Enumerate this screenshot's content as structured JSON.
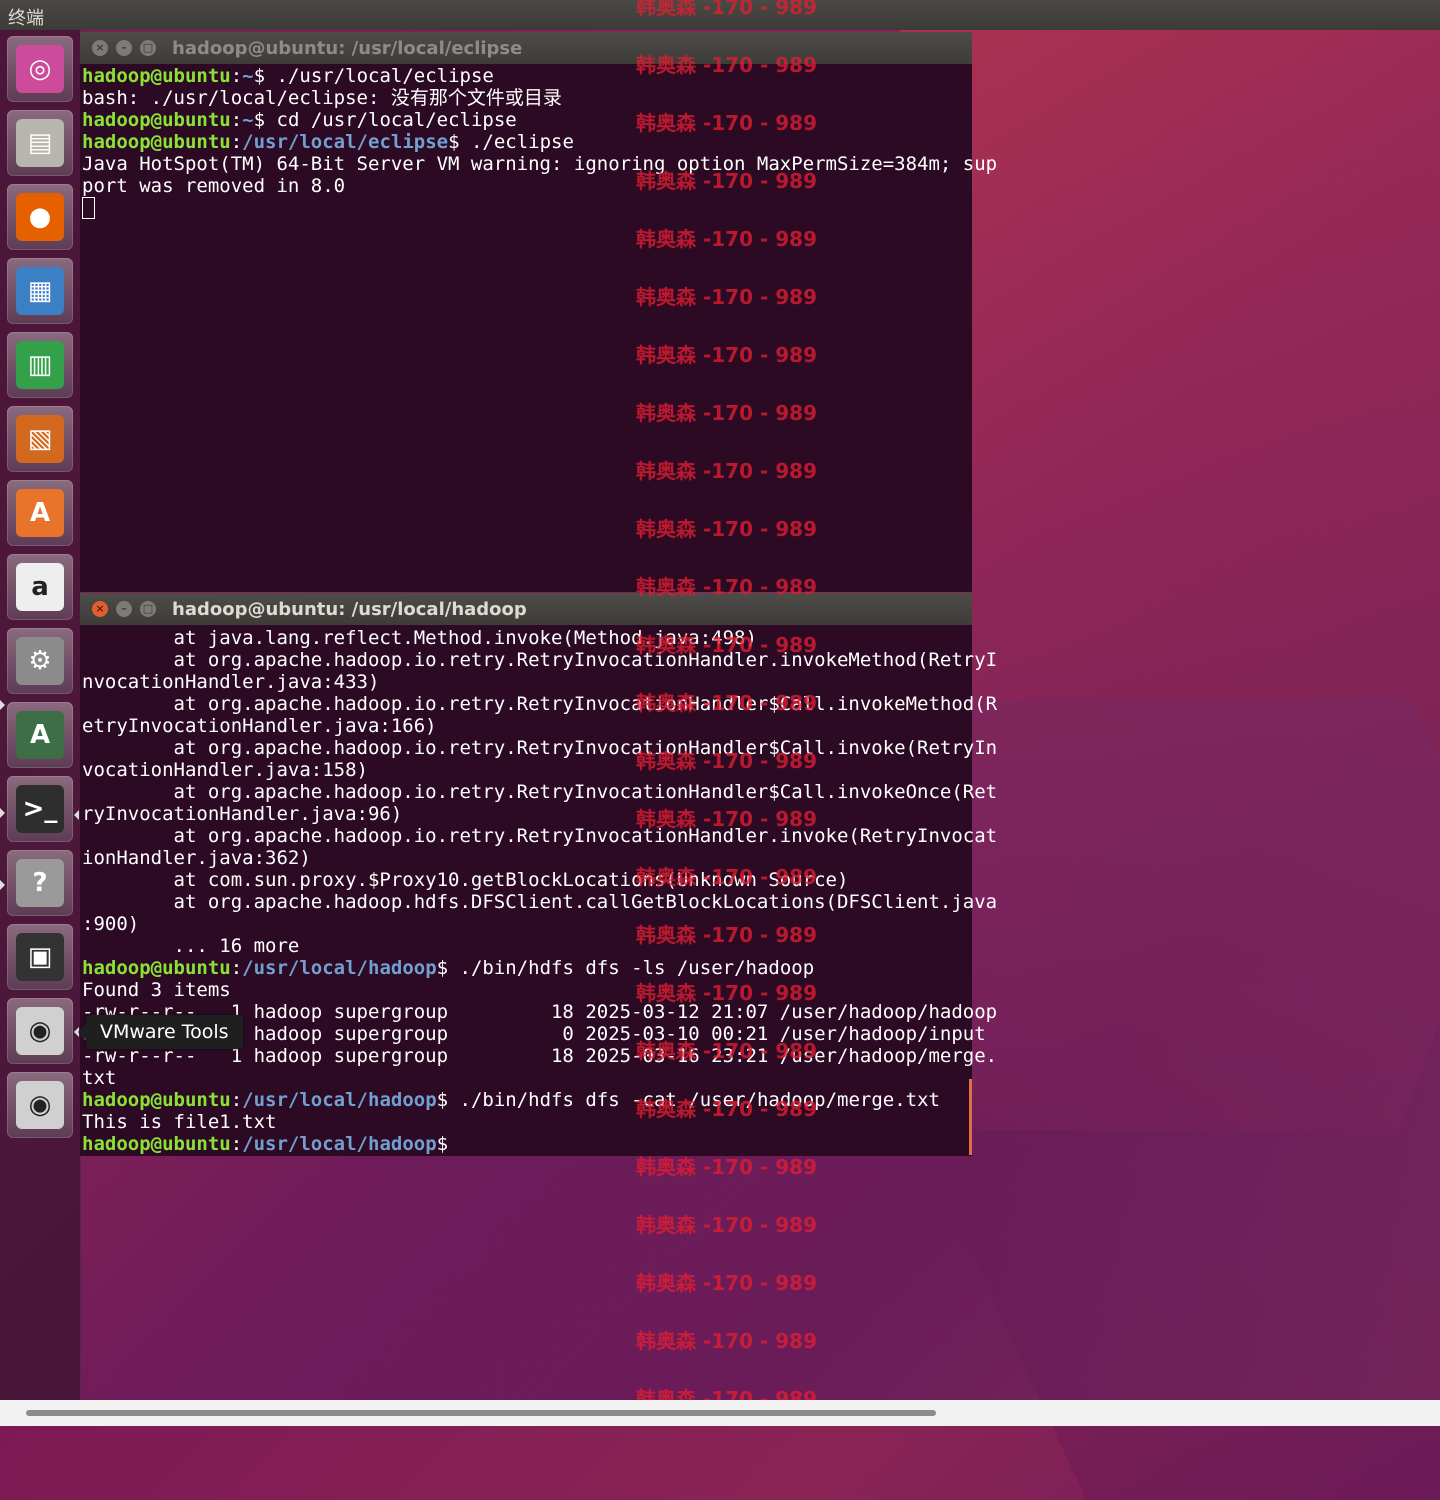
{
  "top_panel": {
    "title": "终端"
  },
  "launcher": {
    "items": [
      {
        "name": "ubuntu-dash",
        "icon": "ubuntu-logo-icon",
        "color": "#cc4b9b"
      },
      {
        "name": "files",
        "icon": "file-cabinet-icon",
        "color": "#b8b4ae"
      },
      {
        "name": "firefox",
        "icon": "firefox-icon",
        "color": "#e66000"
      },
      {
        "name": "libreoffice-writer",
        "icon": "document-icon",
        "color": "#3b7fc4"
      },
      {
        "name": "libreoffice-calc",
        "icon": "spreadsheet-icon",
        "color": "#33a04a"
      },
      {
        "name": "libreoffice-impress",
        "icon": "presentation-icon",
        "color": "#d2691e"
      },
      {
        "name": "software-center",
        "icon": "shopping-bag-icon",
        "color": "#e8742c"
      },
      {
        "name": "amazon",
        "icon": "amazon-icon",
        "color": "#eeeeee"
      },
      {
        "name": "system-settings",
        "icon": "gear-wrench-icon",
        "color": "#8b8b8b"
      },
      {
        "name": "software-updater",
        "icon": "updater-icon",
        "color": "#3d6e45"
      },
      {
        "name": "terminal",
        "icon": "terminal-icon",
        "color": "#2e2e2e"
      },
      {
        "name": "help",
        "icon": "question-mark-icon",
        "color": "#9a9a9a"
      },
      {
        "name": "save-disk",
        "icon": "floppy-disk-icon",
        "color": "#333333"
      },
      {
        "name": "vmware-tools-dvd",
        "icon": "dvd-icon",
        "color": "#d0d0d0"
      },
      {
        "name": "dvd-2",
        "icon": "dvd-icon",
        "color": "#d0d0d0"
      }
    ],
    "tooltip": "VMware Tools"
  },
  "terminal_back": {
    "title": "hadoop@ubuntu: /usr/local/eclipse",
    "lines": [
      {
        "user": "hadoop@ubuntu",
        "colon": ":",
        "path": "~",
        "prompt": "$ ",
        "cmd": "./usr/local/eclipse"
      },
      {
        "text": "bash: ./usr/local/eclipse: 没有那个文件或目录"
      },
      {
        "user": "hadoop@ubuntu",
        "colon": ":",
        "path": "~",
        "prompt": "$ ",
        "cmd": "cd /usr/local/eclipse"
      },
      {
        "user": "hadoop@ubuntu",
        "colon": ":",
        "path": "/usr/local/eclipse",
        "prompt": "$ ",
        "cmd": "./eclipse"
      },
      {
        "text": "Java HotSpot(TM) 64-Bit Server VM warning: ignoring option MaxPermSize=384m; sup"
      },
      {
        "text": "port was removed in 8.0"
      }
    ]
  },
  "terminal_front": {
    "title": "hadoop@ubuntu: /usr/local/hadoop",
    "lines": [
      {
        "text": "        at java.lang.reflect.Method.invoke(Method.java:498)"
      },
      {
        "text": "        at org.apache.hadoop.io.retry.RetryInvocationHandler.invokeMethod(RetryI"
      },
      {
        "text": "nvocationHandler.java:433)"
      },
      {
        "text": "        at org.apache.hadoop.io.retry.RetryInvocationHandler$Call.invokeMethod(R"
      },
      {
        "text": "etryInvocationHandler.java:166)"
      },
      {
        "text": "        at org.apache.hadoop.io.retry.RetryInvocationHandler$Call.invoke(RetryIn"
      },
      {
        "text": "vocationHandler.java:158)"
      },
      {
        "text": "        at org.apache.hadoop.io.retry.RetryInvocationHandler$Call.invokeOnce(Ret"
      },
      {
        "text": "ryInvocationHandler.java:96)"
      },
      {
        "text": "        at org.apache.hadoop.io.retry.RetryInvocationHandler.invoke(RetryInvocat"
      },
      {
        "text": "ionHandler.java:362)"
      },
      {
        "text": "        at com.sun.proxy.$Proxy10.getBlockLocations(Unknown Source)"
      },
      {
        "text": "        at org.apache.hadoop.hdfs.DFSClient.callGetBlockLocations(DFSClient.java"
      },
      {
        "text": ":900)"
      },
      {
        "text": "        ... 16 more"
      },
      {
        "user": "hadoop@ubuntu",
        "colon": ":",
        "path": "/usr/local/hadoop",
        "prompt": "$ ",
        "cmd": "./bin/hdfs dfs -ls /user/hadoop"
      },
      {
        "text": "Found 3 items"
      },
      {
        "text": "-rw-r--r--   1 hadoop supergroup         18 2025-03-12 21:07 /user/hadoop/hadoop"
      },
      {
        "text": "drwxr-xr-x   - hadoop supergroup          0 2025-03-10 00:21 /user/hadoop/input"
      },
      {
        "text": "-rw-r--r--   1 hadoop supergroup         18 2025-03-16 23:21 /user/hadoop/merge."
      },
      {
        "text": "txt"
      },
      {
        "user": "hadoop@ubuntu",
        "colon": ":",
        "path": "/usr/local/hadoop",
        "prompt": "$ ",
        "cmd": "./bin/hdfs dfs -cat /user/hadoop/merge.txt"
      },
      {
        "text": "This is file1.txt"
      },
      {
        "user": "hadoop@ubuntu",
        "colon": ":",
        "path": "/usr/local/hadoop",
        "prompt": "$",
        "cmd": ""
      }
    ]
  },
  "watermark": {
    "text": "韩奥森 -170 - 989",
    "color": "#e11e32"
  },
  "colors": {
    "terminal_bg": "#2c0a24",
    "prompt_user": "#8ae234",
    "prompt_path": "#729fcf",
    "close_button_active": "#e45d2d"
  }
}
